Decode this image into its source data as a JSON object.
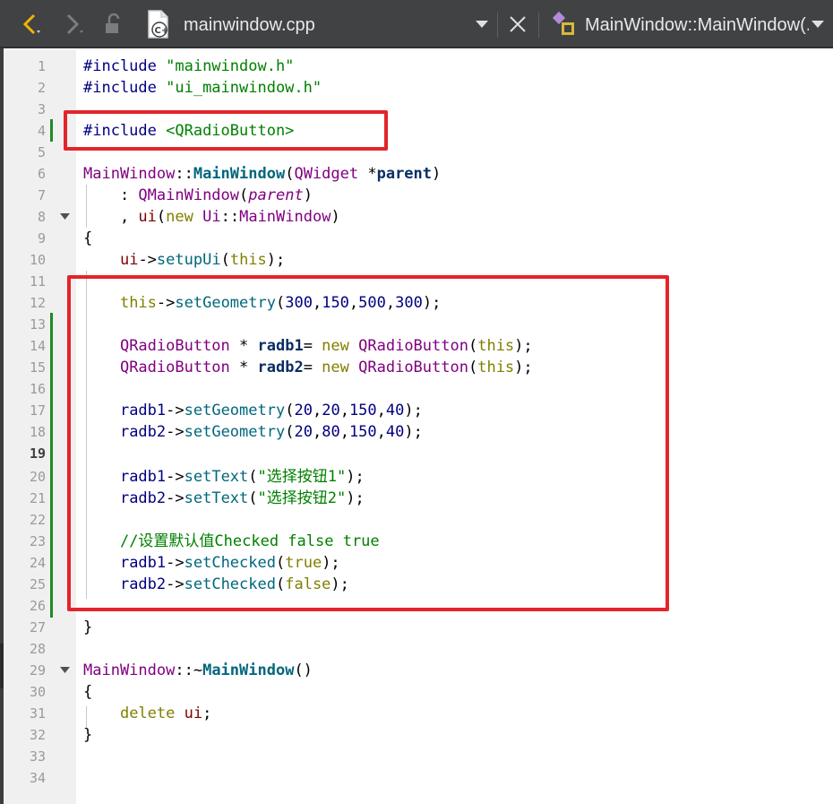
{
  "toolbar": {
    "file_name": "mainwindow.cpp",
    "symbol_name": "MainWindow::MainWindow(..."
  },
  "editor": {
    "current_line": 19,
    "lines": [
      {
        "n": "1",
        "tokens": [
          [
            "t-pre",
            "#include "
          ],
          [
            "t-str",
            "\"mainwindow.h\""
          ]
        ]
      },
      {
        "n": "2",
        "tokens": [
          [
            "t-pre",
            "#include "
          ],
          [
            "t-str",
            "\"ui_mainwindow.h\""
          ]
        ]
      },
      {
        "n": "3",
        "tokens": []
      },
      {
        "n": "4",
        "tokens": [
          [
            "t-pre",
            "#include "
          ],
          [
            "t-str",
            "<QRadioButton>"
          ]
        ]
      },
      {
        "n": "5",
        "tokens": []
      },
      {
        "n": "6",
        "tokens": [
          [
            "t-type",
            "MainWindow"
          ],
          [
            "t-plain",
            "::"
          ],
          [
            "t-func",
            "MainWindow"
          ],
          [
            "t-plain",
            "("
          ],
          [
            "t-type",
            "QWidget"
          ],
          [
            "t-plain",
            " *"
          ],
          [
            "t-param",
            "parent"
          ],
          [
            "t-plain",
            ")"
          ]
        ]
      },
      {
        "n": "7",
        "tokens": [
          [
            "t-plain",
            "    : "
          ],
          [
            "t-type",
            "QMainWindow"
          ],
          [
            "t-plain",
            "("
          ],
          [
            "t-italic",
            "parent"
          ],
          [
            "t-plain",
            ")"
          ]
        ]
      },
      {
        "n": "8",
        "tokens": [
          [
            "t-plain",
            "    , "
          ],
          [
            "t-member",
            "ui"
          ],
          [
            "t-plain",
            "("
          ],
          [
            "t-kw",
            "new"
          ],
          [
            "t-plain",
            " "
          ],
          [
            "t-type",
            "Ui"
          ],
          [
            "t-plain",
            "::"
          ],
          [
            "t-type",
            "MainWindow"
          ],
          [
            "t-plain",
            ")"
          ]
        ]
      },
      {
        "n": "9",
        "tokens": [
          [
            "t-plain",
            "{"
          ]
        ]
      },
      {
        "n": "10",
        "tokens": [
          [
            "t-plain",
            "    "
          ],
          [
            "t-member",
            "ui"
          ],
          [
            "t-plain",
            "->"
          ],
          [
            "t-call",
            "setupUi"
          ],
          [
            "t-plain",
            "("
          ],
          [
            "t-kw",
            "this"
          ],
          [
            "t-plain",
            ");"
          ]
        ]
      },
      {
        "n": "11",
        "tokens": []
      },
      {
        "n": "12",
        "tokens": [
          [
            "t-plain",
            "    "
          ],
          [
            "t-kw",
            "this"
          ],
          [
            "t-plain",
            "->"
          ],
          [
            "t-call",
            "setGeometry"
          ],
          [
            "t-plain",
            "("
          ],
          [
            "t-num",
            "300"
          ],
          [
            "t-plain",
            ","
          ],
          [
            "t-num",
            "150"
          ],
          [
            "t-plain",
            ","
          ],
          [
            "t-num",
            "500"
          ],
          [
            "t-plain",
            ","
          ],
          [
            "t-num",
            "300"
          ],
          [
            "t-plain",
            ");"
          ]
        ]
      },
      {
        "n": "13",
        "tokens": []
      },
      {
        "n": "14",
        "tokens": [
          [
            "t-plain",
            "    "
          ],
          [
            "t-type",
            "QRadioButton"
          ],
          [
            "t-plain",
            " * "
          ],
          [
            "t-param",
            "radb1"
          ],
          [
            "t-plain",
            "= "
          ],
          [
            "t-kw",
            "new"
          ],
          [
            "t-plain",
            " "
          ],
          [
            "t-type",
            "QRadioButton"
          ],
          [
            "t-plain",
            "("
          ],
          [
            "t-kw",
            "this"
          ],
          [
            "t-plain",
            ");"
          ]
        ]
      },
      {
        "n": "15",
        "tokens": [
          [
            "t-plain",
            "    "
          ],
          [
            "t-type",
            "QRadioButton"
          ],
          [
            "t-plain",
            " * "
          ],
          [
            "t-param",
            "radb2"
          ],
          [
            "t-plain",
            "= "
          ],
          [
            "t-kw",
            "new"
          ],
          [
            "t-plain",
            " "
          ],
          [
            "t-type",
            "QRadioButton"
          ],
          [
            "t-plain",
            "("
          ],
          [
            "t-kw",
            "this"
          ],
          [
            "t-plain",
            ");"
          ]
        ]
      },
      {
        "n": "16",
        "tokens": []
      },
      {
        "n": "17",
        "tokens": [
          [
            "t-plain",
            "    "
          ],
          [
            "t-pre",
            "radb1"
          ],
          [
            "t-plain",
            "->"
          ],
          [
            "t-call",
            "setGeometry"
          ],
          [
            "t-plain",
            "("
          ],
          [
            "t-num",
            "20"
          ],
          [
            "t-plain",
            ","
          ],
          [
            "t-num",
            "20"
          ],
          [
            "t-plain",
            ","
          ],
          [
            "t-num",
            "150"
          ],
          [
            "t-plain",
            ","
          ],
          [
            "t-num",
            "40"
          ],
          [
            "t-plain",
            ");"
          ]
        ]
      },
      {
        "n": "18",
        "tokens": [
          [
            "t-plain",
            "    "
          ],
          [
            "t-pre",
            "radb2"
          ],
          [
            "t-plain",
            "->"
          ],
          [
            "t-call",
            "setGeometry"
          ],
          [
            "t-plain",
            "("
          ],
          [
            "t-num",
            "20"
          ],
          [
            "t-plain",
            ","
          ],
          [
            "t-num",
            "80"
          ],
          [
            "t-plain",
            ","
          ],
          [
            "t-num",
            "150"
          ],
          [
            "t-plain",
            ","
          ],
          [
            "t-num",
            "40"
          ],
          [
            "t-plain",
            ");"
          ]
        ]
      },
      {
        "n": "19",
        "tokens": []
      },
      {
        "n": "20",
        "tokens": [
          [
            "t-plain",
            "    "
          ],
          [
            "t-pre",
            "radb1"
          ],
          [
            "t-plain",
            "->"
          ],
          [
            "t-call",
            "setText"
          ],
          [
            "t-plain",
            "("
          ],
          [
            "t-str",
            "\"选择按钮1\""
          ],
          [
            "t-plain",
            ");"
          ]
        ]
      },
      {
        "n": "21",
        "tokens": [
          [
            "t-plain",
            "    "
          ],
          [
            "t-pre",
            "radb2"
          ],
          [
            "t-plain",
            "->"
          ],
          [
            "t-call",
            "setText"
          ],
          [
            "t-plain",
            "("
          ],
          [
            "t-str",
            "\"选择按钮2\""
          ],
          [
            "t-plain",
            ");"
          ]
        ]
      },
      {
        "n": "22",
        "tokens": []
      },
      {
        "n": "23",
        "tokens": [
          [
            "t-plain",
            "    "
          ],
          [
            "t-cmt",
            "//设置默认值Checked false true"
          ]
        ]
      },
      {
        "n": "24",
        "tokens": [
          [
            "t-plain",
            "    "
          ],
          [
            "t-pre",
            "radb1"
          ],
          [
            "t-plain",
            "->"
          ],
          [
            "t-call",
            "setChecked"
          ],
          [
            "t-plain",
            "("
          ],
          [
            "t-kw",
            "true"
          ],
          [
            "t-plain",
            ");"
          ]
        ]
      },
      {
        "n": "25",
        "tokens": [
          [
            "t-plain",
            "    "
          ],
          [
            "t-pre",
            "radb2"
          ],
          [
            "t-plain",
            "->"
          ],
          [
            "t-call",
            "setChecked"
          ],
          [
            "t-plain",
            "("
          ],
          [
            "t-kw",
            "false"
          ],
          [
            "t-plain",
            ");"
          ]
        ]
      },
      {
        "n": "26",
        "tokens": []
      },
      {
        "n": "27",
        "tokens": [
          [
            "t-plain",
            "}"
          ]
        ]
      },
      {
        "n": "28",
        "tokens": []
      },
      {
        "n": "29",
        "tokens": [
          [
            "t-type",
            "MainWindow"
          ],
          [
            "t-plain",
            "::~"
          ],
          [
            "t-func",
            "MainWindow"
          ],
          [
            "t-plain",
            "()"
          ]
        ]
      },
      {
        "n": "30",
        "tokens": [
          [
            "t-plain",
            "{"
          ]
        ]
      },
      {
        "n": "31",
        "tokens": [
          [
            "t-plain",
            "    "
          ],
          [
            "t-kw",
            "delete"
          ],
          [
            "t-plain",
            " "
          ],
          [
            "t-member",
            "ui"
          ],
          [
            "t-plain",
            ";"
          ]
        ]
      },
      {
        "n": "32",
        "tokens": [
          [
            "t-plain",
            "}"
          ]
        ]
      },
      {
        "n": "33",
        "tokens": []
      },
      {
        "n": "34",
        "tokens": []
      }
    ]
  },
  "colors": {
    "toolbar_bg": "#404244",
    "gutter_bg": "#f0f0f0",
    "highlight_box": "#e3242b",
    "modified_marker": "#1f8a1f"
  }
}
